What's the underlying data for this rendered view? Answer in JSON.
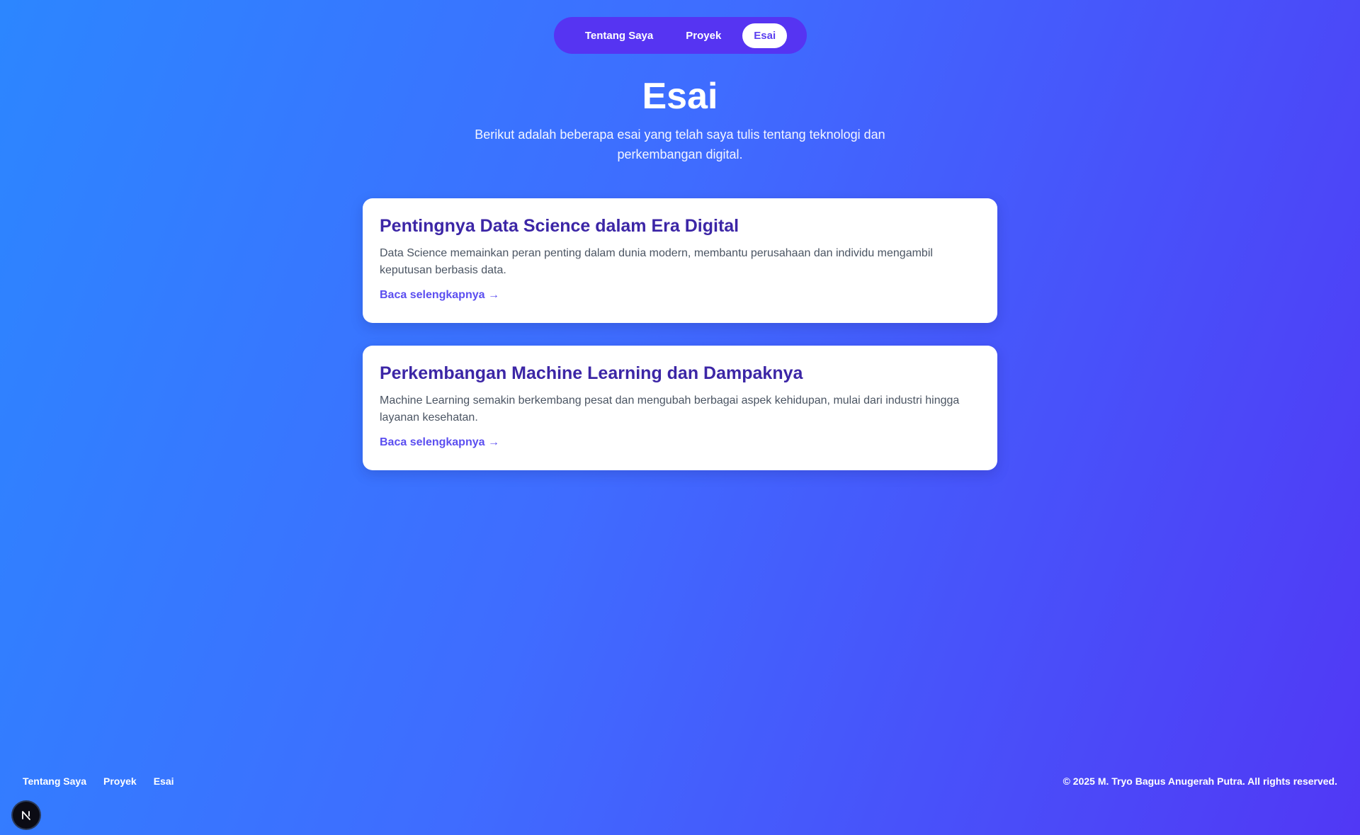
{
  "nav": {
    "items": [
      {
        "label": "Tentang Saya",
        "active": false
      },
      {
        "label": "Proyek",
        "active": false
      },
      {
        "label": "Esai",
        "active": true
      }
    ]
  },
  "header": {
    "title": "Esai",
    "subtitle": "Berikut adalah beberapa esai yang telah saya tulis tentang teknologi dan perkembangan digital."
  },
  "essays": [
    {
      "title": "Pentingnya Data Science dalam Era Digital",
      "description": "Data Science memainkan peran penting dalam dunia modern, membantu perusahaan dan individu mengambil keputusan berbasis data.",
      "link_label": "Baca selengkapnya →"
    },
    {
      "title": "Perkembangan Machine Learning dan Dampaknya",
      "description": "Machine Learning semakin berkembang pesat dan mengubah berbagai aspek kehidupan, mulai dari industri hingga layanan kesehatan.",
      "link_label": "Baca selengkapnya →"
    }
  ],
  "footer": {
    "links": [
      "Tentang Saya",
      "Proyek",
      "Esai"
    ],
    "copyright": "© 2025 M. Tryo Bagus Anugerah Putra. All rights reserved."
  },
  "dev_badge": {
    "icon": "nextjs-logo-icon"
  },
  "colors": {
    "background_start": "#2c86ff",
    "background_end": "#5138f5",
    "nav_pill": "#5634f2",
    "card_title": "#3c26a6",
    "card_link": "#5b4ef0",
    "card_text": "#4b5563"
  }
}
